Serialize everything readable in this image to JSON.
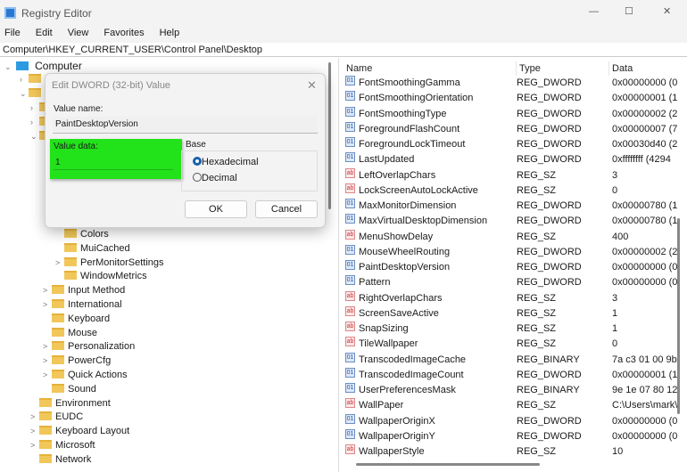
{
  "window": {
    "title": "Registry Editor",
    "minimize": "—",
    "maximize": "☐",
    "close": "✕"
  },
  "menu": [
    "File",
    "Edit",
    "View",
    "Favorites",
    "Help"
  ],
  "address": "Computer\\HKEY_CURRENT_USER\\Control Panel\\Desktop",
  "tree": {
    "root": "Computer",
    "items": [
      {
        "label": "Colors",
        "chev": ""
      },
      {
        "label": "MuiCached",
        "chev": ""
      },
      {
        "label": "PerMonitorSettings",
        "chev": ">"
      },
      {
        "label": "WindowMetrics",
        "chev": ""
      },
      {
        "label": "Input Method",
        "chev": ">"
      },
      {
        "label": "International",
        "chev": ">"
      },
      {
        "label": "Keyboard",
        "chev": ""
      },
      {
        "label": "Mouse",
        "chev": ""
      },
      {
        "label": "Personalization",
        "chev": ">"
      },
      {
        "label": "PowerCfg",
        "chev": ">"
      },
      {
        "label": "Quick Actions",
        "chev": ">"
      },
      {
        "label": "Sound",
        "chev": ""
      },
      {
        "label": "Environment",
        "chev": ""
      },
      {
        "label": "EUDC",
        "chev": ">"
      },
      {
        "label": "Keyboard Layout",
        "chev": ">"
      },
      {
        "label": "Microsoft",
        "chev": ">"
      },
      {
        "label": "Network",
        "chev": ""
      }
    ]
  },
  "columns": {
    "name": "Name",
    "type": "Type",
    "data": "Data"
  },
  "values": [
    {
      "name": "FontSmoothingGamma",
      "type": "REG_DWORD",
      "data": "0x00000000 (0"
    },
    {
      "name": "FontSmoothingOrientation",
      "type": "REG_DWORD",
      "data": "0x00000001 (1"
    },
    {
      "name": "FontSmoothingType",
      "type": "REG_DWORD",
      "data": "0x00000002 (2"
    },
    {
      "name": "ForegroundFlashCount",
      "type": "REG_DWORD",
      "data": "0x00000007 (7"
    },
    {
      "name": "ForegroundLockTimeout",
      "type": "REG_DWORD",
      "data": "0x00030d40 (2"
    },
    {
      "name": "LastUpdated",
      "type": "REG_DWORD",
      "data": "0xffffffff (4294"
    },
    {
      "name": "LeftOverlapChars",
      "type": "REG_SZ",
      "data": "3"
    },
    {
      "name": "LockScreenAutoLockActive",
      "type": "REG_SZ",
      "data": "0"
    },
    {
      "name": "MaxMonitorDimension",
      "type": "REG_DWORD",
      "data": "0x00000780 (1"
    },
    {
      "name": "MaxVirtualDesktopDimension",
      "type": "REG_DWORD",
      "data": "0x00000780 (1"
    },
    {
      "name": "MenuShowDelay",
      "type": "REG_SZ",
      "data": "400"
    },
    {
      "name": "MouseWheelRouting",
      "type": "REG_DWORD",
      "data": "0x00000002 (2"
    },
    {
      "name": "PaintDesktopVersion",
      "type": "REG_DWORD",
      "data": "0x00000000 (0"
    },
    {
      "name": "Pattern",
      "type": "REG_DWORD",
      "data": "0x00000000 (0"
    },
    {
      "name": "RightOverlapChars",
      "type": "REG_SZ",
      "data": "3"
    },
    {
      "name": "ScreenSaveActive",
      "type": "REG_SZ",
      "data": "1"
    },
    {
      "name": "SnapSizing",
      "type": "REG_SZ",
      "data": "1"
    },
    {
      "name": "TileWallpaper",
      "type": "REG_SZ",
      "data": "0"
    },
    {
      "name": "TranscodedImageCache",
      "type": "REG_BINARY",
      "data": "7a c3 01 00 9b"
    },
    {
      "name": "TranscodedImageCount",
      "type": "REG_DWORD",
      "data": "0x00000001 (1"
    },
    {
      "name": "UserPreferencesMask",
      "type": "REG_BINARY",
      "data": "9e 1e 07 80 12"
    },
    {
      "name": "WallPaper",
      "type": "REG_SZ",
      "data": "C:\\Users\\mark\\"
    },
    {
      "name": "WallpaperOriginX",
      "type": "REG_DWORD",
      "data": "0x00000000 (0"
    },
    {
      "name": "WallpaperOriginY",
      "type": "REG_DWORD",
      "data": "0x00000000 (0"
    },
    {
      "name": "WallpaperStyle",
      "type": "REG_SZ",
      "data": "10"
    }
  ],
  "dialog": {
    "title": "Edit DWORD (32-bit) Value",
    "close": "✕",
    "value_name_label": "Value name:",
    "value_name": "PaintDesktopVersion",
    "value_data_label": "Value data:",
    "value_data": "1",
    "base_label": "Base",
    "hex": "Hexadecimal",
    "dec": "Decimal",
    "ok": "OK",
    "cancel": "Cancel",
    "highlight": "#22e21a"
  }
}
